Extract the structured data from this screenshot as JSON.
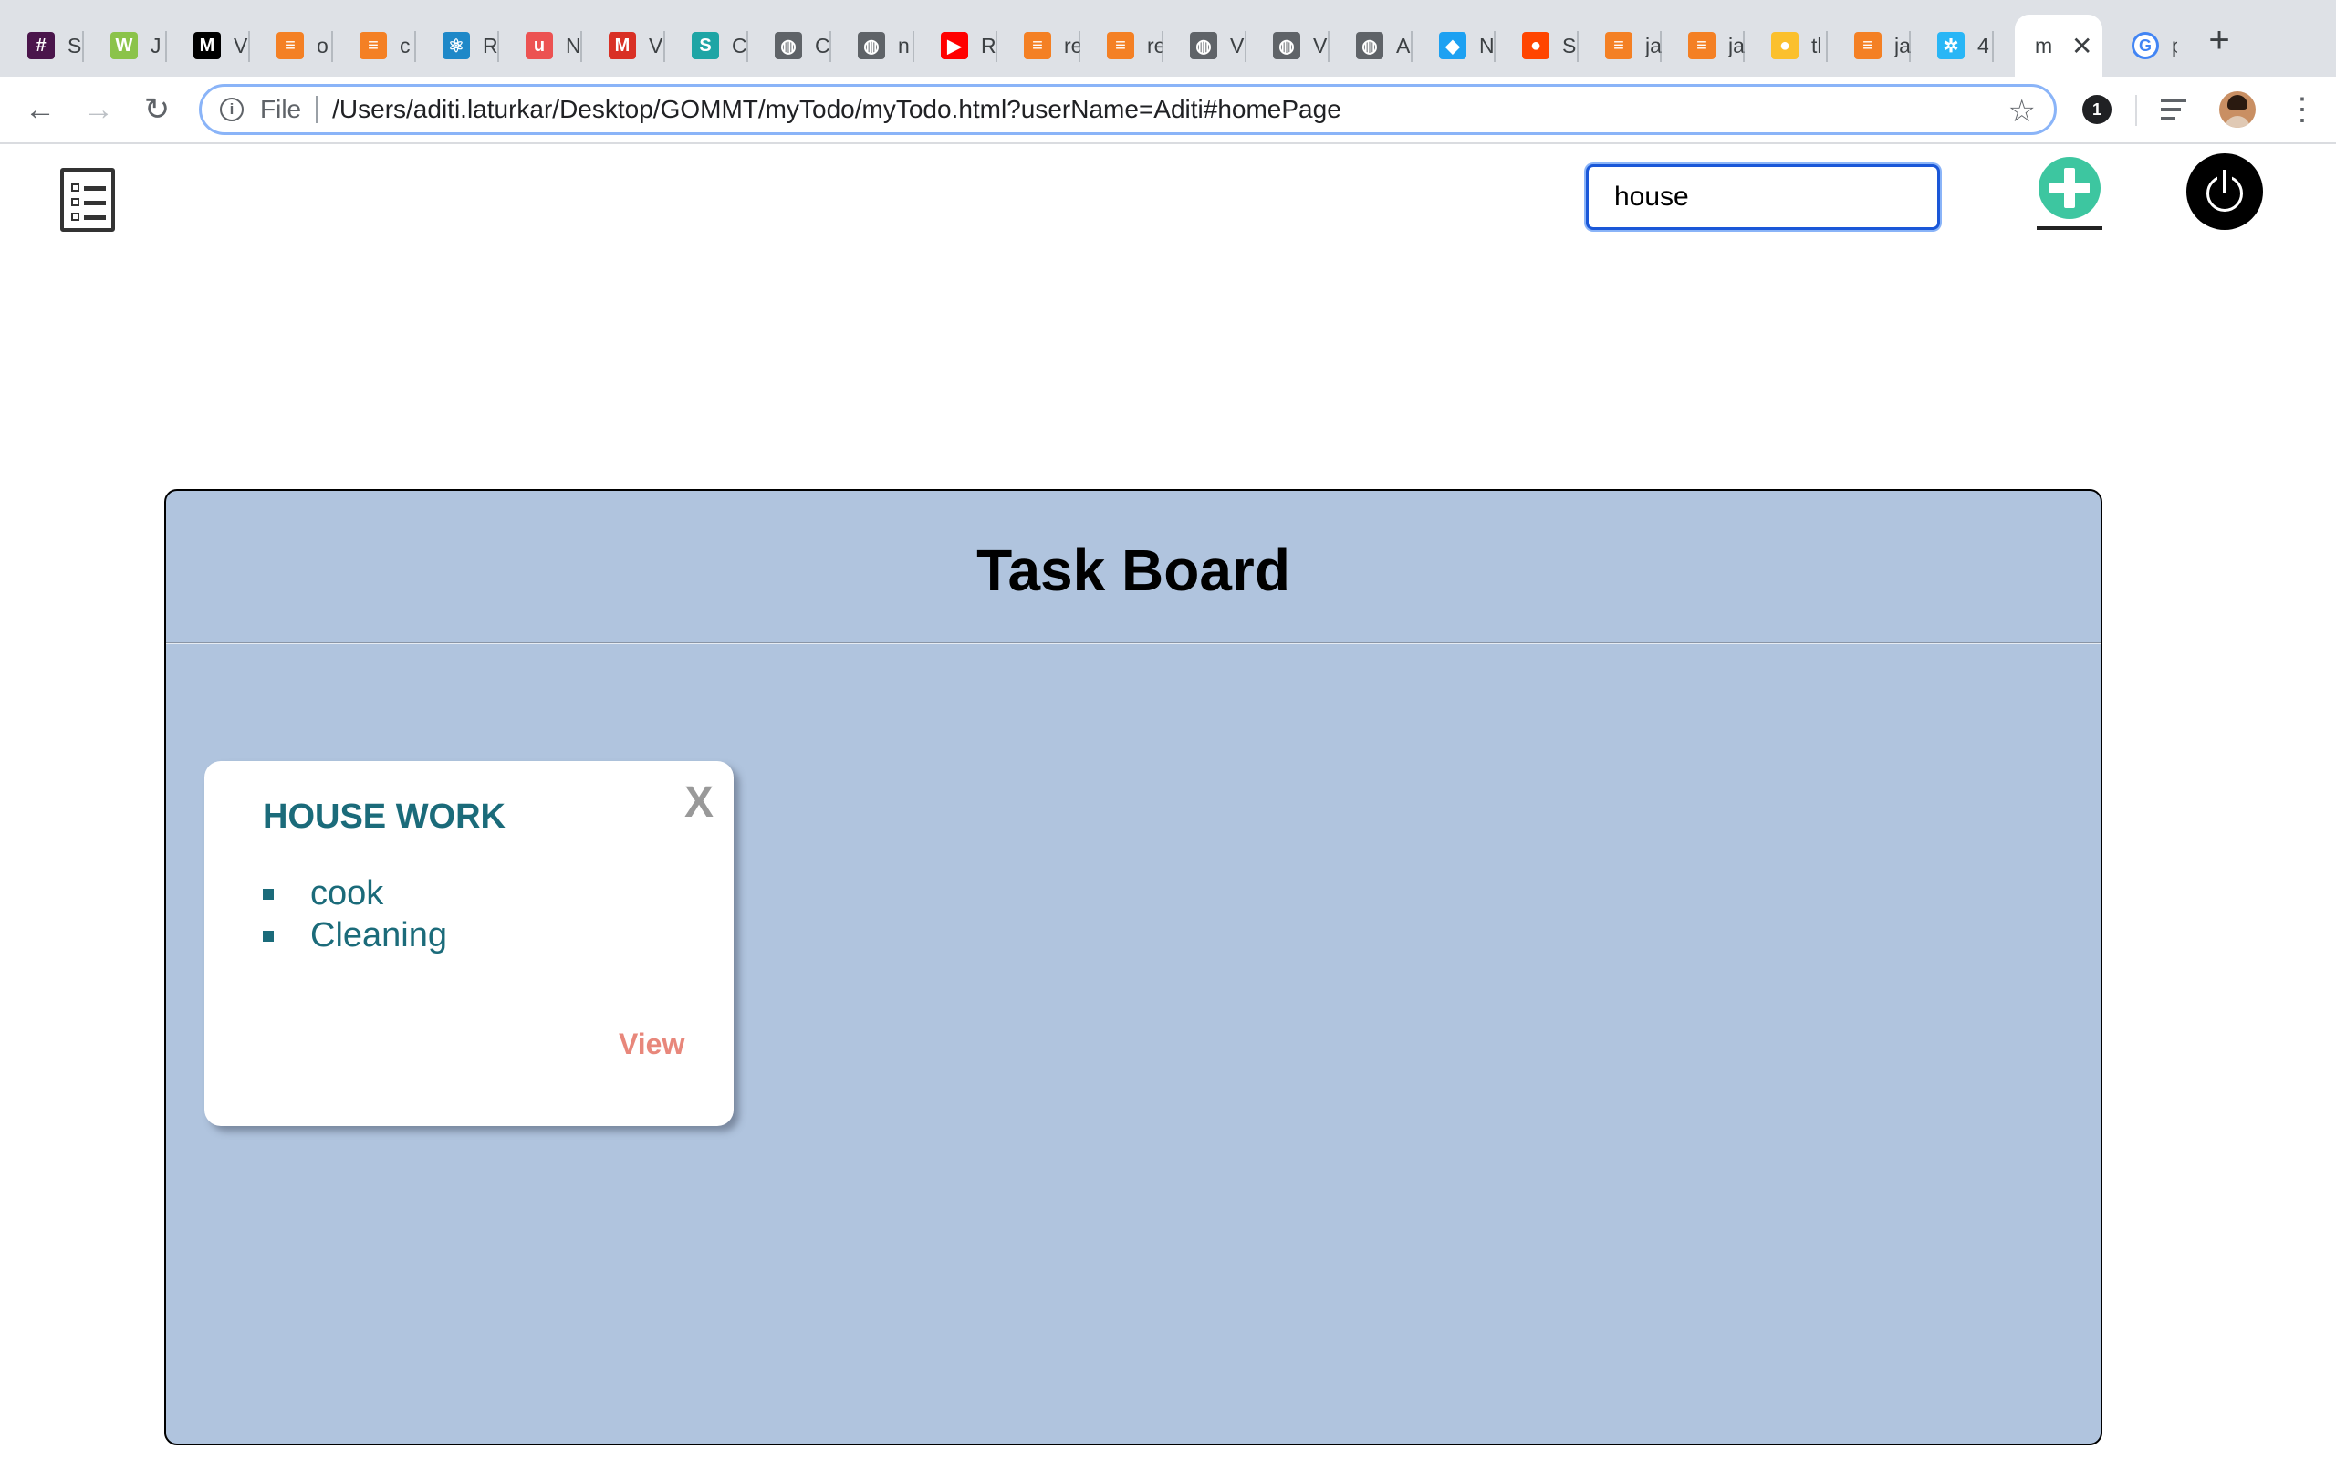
{
  "browser": {
    "tabs": [
      {
        "title": "S",
        "icon": "slack-icon",
        "color": "#4a154b"
      },
      {
        "title": "J",
        "icon": "w3c-icon",
        "color": "#8bc34a"
      },
      {
        "title": "V",
        "icon": "medium-icon",
        "color": "#000000"
      },
      {
        "title": "o",
        "icon": "stackoverflow-icon",
        "color": "#f48024"
      },
      {
        "title": "c",
        "icon": "stackoverflow-icon",
        "color": "#f48024"
      },
      {
        "title": "R",
        "icon": "react-icon",
        "color": "#1e88c8"
      },
      {
        "title": "N",
        "icon": "udemy-icon",
        "color": "#ec5252"
      },
      {
        "title": "V",
        "icon": "gmail-icon",
        "color": "#d93025"
      },
      {
        "title": "C",
        "icon": "scribd-icon",
        "color": "#1ea5a5"
      },
      {
        "title": "C",
        "icon": "globe-icon",
        "color": "#5f6368"
      },
      {
        "title": "n",
        "icon": "globe-icon",
        "color": "#5f6368"
      },
      {
        "title": "R",
        "icon": "youtube-icon",
        "color": "#ff0000"
      },
      {
        "title": "re",
        "icon": "stackoverflow-icon",
        "color": "#f48024"
      },
      {
        "title": "re",
        "icon": "stackoverflow-icon",
        "color": "#f48024"
      },
      {
        "title": "V",
        "icon": "globe-icon",
        "color": "#5f6368"
      },
      {
        "title": "V",
        "icon": "globe-icon",
        "color": "#5f6368"
      },
      {
        "title": "A",
        "icon": "globe-icon",
        "color": "#5f6368"
      },
      {
        "title": "N",
        "icon": "bird-icon",
        "color": "#1da1f2"
      },
      {
        "title": "S",
        "icon": "reddit-icon",
        "color": "#ff4500"
      },
      {
        "title": "ja",
        "icon": "stackoverflow-icon",
        "color": "#f48024"
      },
      {
        "title": "ja",
        "icon": "stackoverflow-icon",
        "color": "#f48024"
      },
      {
        "title": "tl",
        "icon": "bulb-icon",
        "color": "#fbc02d"
      },
      {
        "title": "ja",
        "icon": "stackoverflow-icon",
        "color": "#f48024"
      },
      {
        "title": "4",
        "icon": "codebeautify-icon",
        "color": "#29b6f6"
      }
    ],
    "active_tab": {
      "title": "m",
      "close_glyph": "✕"
    },
    "extra_tab": {
      "title": "p",
      "icon": "google-icon"
    },
    "new_tab_glyph": "+",
    "omnibox": {
      "info_glyph": "i",
      "scheme": "File",
      "url": "/Users/aditi.laturkar/Desktop/GOMMT/myTodo/myTodo.html?userName=Aditi#homePage",
      "star_glyph": "☆"
    },
    "nav": {
      "back": "←",
      "forward": "→",
      "reload": "↻"
    },
    "extension_badge": "1",
    "menu_glyph": "⋮"
  },
  "app": {
    "search_value": "house",
    "board_title": "Task Board",
    "cards": [
      {
        "title": "HOUSE WORK",
        "close_label": "X",
        "items": [
          "cook",
          "Cleaning"
        ],
        "view_label": "View"
      }
    ]
  },
  "colors": {
    "board_bg": "#b0c4de",
    "card_title": "#1b6b7a",
    "view_link": "#e8877b",
    "add_button": "#3dc6a0"
  }
}
